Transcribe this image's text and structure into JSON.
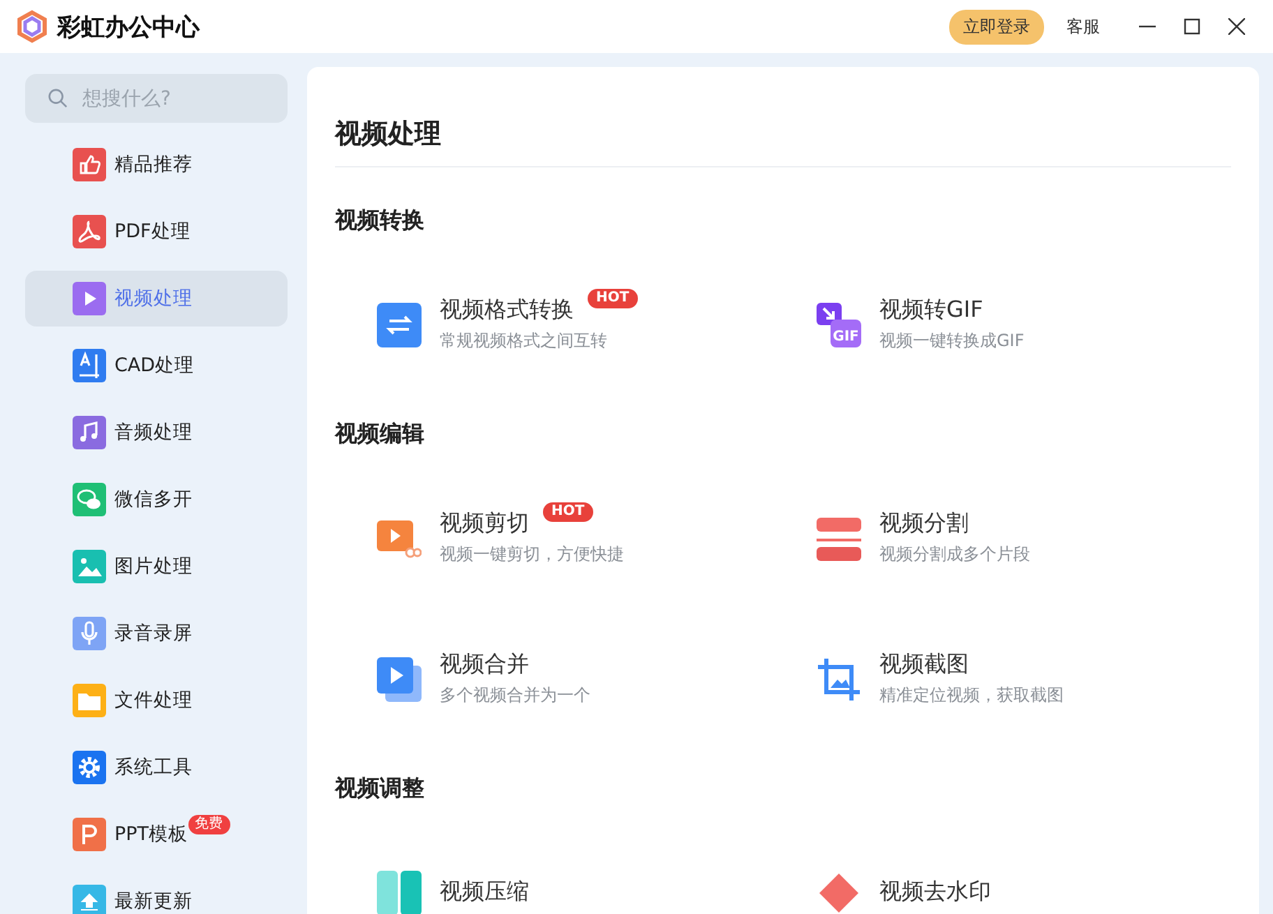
{
  "window": {
    "title": "彩虹办公中心",
    "login_button": "立即登录",
    "service_link": "客服"
  },
  "sidebar": {
    "search": {
      "placeholder": "想搜什么?"
    },
    "items": [
      {
        "label": "精品推荐",
        "kind": "thumb",
        "selected": false
      },
      {
        "label": "PDF处理",
        "kind": "pdf",
        "selected": false
      },
      {
        "label": "视频处理",
        "kind": "play",
        "selected": true
      },
      {
        "label": "CAD处理",
        "kind": "cad",
        "selected": false
      },
      {
        "label": "音频处理",
        "kind": "music",
        "selected": false
      },
      {
        "label": "微信多开",
        "kind": "chat",
        "selected": false
      },
      {
        "label": "图片处理",
        "kind": "image",
        "selected": false
      },
      {
        "label": "录音录屏",
        "kind": "mic",
        "selected": false
      },
      {
        "label": "文件处理",
        "kind": "folder",
        "selected": false
      },
      {
        "label": "系统工具",
        "kind": "gear",
        "selected": false
      },
      {
        "label": "PPT模板",
        "kind": "ppt",
        "selected": false,
        "badge": "免费"
      },
      {
        "label": "最新更新",
        "kind": "upload",
        "selected": false
      }
    ]
  },
  "main": {
    "title": "视频处理",
    "sections": [
      {
        "title": "视频转换",
        "tools": [
          {
            "name": "视频格式转换",
            "description": "常规视频格式之间互转",
            "kind": "swap",
            "badge": "HOT"
          },
          {
            "name": "视频转GIF",
            "description": "视频一键转换成GIF",
            "kind": "gif",
            "icon_text": "GIF"
          }
        ]
      },
      {
        "title": "视频编辑",
        "tools": [
          {
            "name": "视频剪切",
            "description": "视频一键剪切，方便快捷",
            "kind": "cut",
            "badge": "HOT"
          },
          {
            "name": "视频分割",
            "description": "视频分割成多个片段",
            "kind": "split"
          },
          {
            "name": "视频合并",
            "description": "多个视频合并为一个",
            "kind": "merge"
          },
          {
            "name": "视频截图",
            "description": "精准定位视频，获取截图",
            "kind": "crop"
          }
        ]
      },
      {
        "title": "视频调整",
        "tools": [
          {
            "name": "视频压缩",
            "kind": "compress"
          },
          {
            "name": "视频去水印",
            "kind": "watermark"
          }
        ]
      }
    ]
  }
}
